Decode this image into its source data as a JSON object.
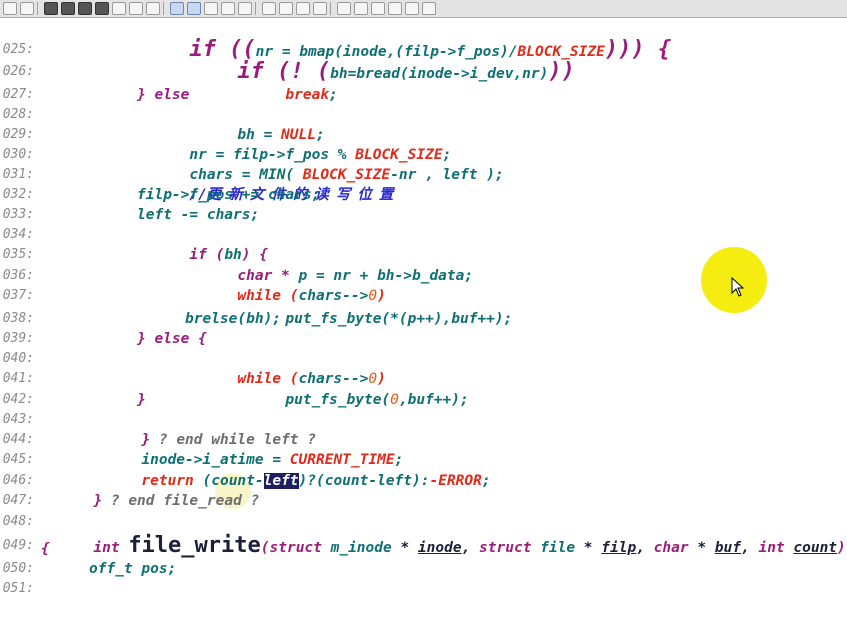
{
  "window": {
    "width": 847,
    "height": 590
  },
  "colors": {
    "keyword": "#9b1c7c",
    "identifier": "#0e6f74",
    "constant": "#e02a1a",
    "number": "#e05a1a",
    "comment": "#6e6e6e",
    "chinese_comment": "#2a2acd",
    "line_number": "#8a8a8a",
    "selection": "#1d1d60",
    "cursor_highlight": "#f4ec05"
  },
  "toolbar": {
    "buttons": [
      "undo-icon",
      "redo-icon",
      "find-icon",
      "find-prev-icon",
      "find-next-icon",
      "replace-icon",
      "bookmark-icon",
      "goto-icon",
      "hex-icon",
      "back-icon",
      "forward-icon",
      "jump-icon",
      "match-brace-icon",
      "lookup-icon",
      "list-icon",
      "tile-icon",
      "cascade-icon",
      "window-icon",
      "page-icon",
      "marker-icon",
      "toggle-icon",
      "wrap-icon",
      "highlight-icon",
      "settings-icon"
    ]
  },
  "line_numbers": {
    "l025": "025:",
    "l026": "026:",
    "l027": "027:",
    "l028": "028:",
    "l029": "029:",
    "l030": "030:",
    "l031": "031:",
    "l032": "032:",
    "l033": "033:",
    "l034": "034:",
    "l035": "035:",
    "l036": "036:",
    "l037": "037:",
    "l038": "038:",
    "l039": "039:",
    "l040": "040:",
    "l041": "041:",
    "l042": "042:",
    "l043": "043:",
    "l044": "044:",
    "l045": "045:",
    "l046": "046:",
    "l047": "047:",
    "l048": "048:",
    "l049": "049:",
    "l050": "050:",
    "l051": "051:"
  },
  "code": {
    "l025_a": "if ((",
    "l025_b": "nr = bmap(inode,(filp->f_pos)/",
    "l025_c": "BLOCK_SIZE",
    "l025_d": "))) {",
    "l026_a": "if (! (",
    "l026_b": "bh=bread(inode->i_dev,nr)",
    "l026_c": "))",
    "l027_a": "break",
    "l027_b": ";",
    "l028_a": "} else",
    "l029_a": "bh = ",
    "l029_b": "NULL",
    "l029_c": ";",
    "l030_a": "nr = filp->f_pos % ",
    "l030_b": "BLOCK_SIZE",
    "l030_c": ";",
    "l031_a": "chars = MIN( ",
    "l031_b": "BLOCK_SIZE",
    "l031_c": "-nr , left );",
    "l032_a": "//",
    "l032_b": "更新文件的读写位置",
    "l033_a": "filp->f_pos += chars;",
    "l034_a": "left -= chars;",
    "l035_a": "if (",
    "l035_b": "bh",
    "l035_c": ") {",
    "l036_a": "char * ",
    "l036_b": "p = nr + bh->b_data;",
    "l037_a": "while (",
    "l037_b": "chars-->",
    "l037_c": "0",
    "l037_d": ")",
    "l038_a": "put_fs_byte(",
    "l038_b": "*(p++),buf++);",
    "l039_a": "brelse(bh);",
    "l040_a": "} else {",
    "l041_a": "while (",
    "l041_b": "chars-->",
    "l041_c": "0",
    "l041_d": ")",
    "l042_a": "put_fs_byte(",
    "l042_b": "0",
    "l042_c": ",buf++);",
    "l043_a": "}",
    "l044_a": "}",
    "l044_b": " ? end while left ?",
    "l045_a": "inode->i_atime = ",
    "l045_b": "CURRENT_TIME",
    "l045_c": ";",
    "l046_a": "return ",
    "l046_b": "(count-",
    "l046_c": "left",
    "l046_d": ")?(count-left):",
    "l046_e": "-ERROR",
    "l046_f": ";",
    "l047_a": "}",
    "l047_b": " ? end file_read ?",
    "l049_a": "int ",
    "l049_b": "file_write",
    "l049_c": "(",
    "l049_d": "struct ",
    "l049_e": "m_inode",
    "l049_f": " * ",
    "l049_g": "inode",
    "l049_h": ", ",
    "l049_i": "struct ",
    "l049_j": "file",
    "l049_k": " * ",
    "l049_l": "filp",
    "l049_m": ", ",
    "l049_n": "char ",
    "l049_o": "* ",
    "l049_p": "buf",
    "l049_q": ", ",
    "l049_r": "int ",
    "l049_s": "count",
    "l049_t": ")",
    "l050_a": "{",
    "l051_a": "off_t pos;"
  }
}
